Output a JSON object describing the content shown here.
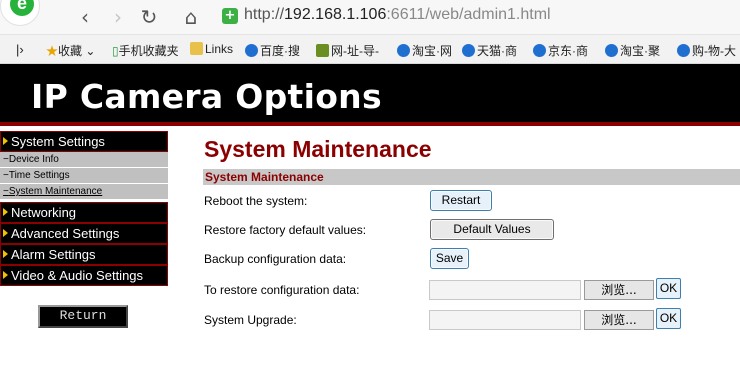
{
  "browser": {
    "url_prefix": "http://",
    "url_host": "192.168.1.106",
    "url_rest": ":6611/web/admin1.html",
    "bookmarks": [
      {
        "label": "收藏",
        "icon": "star-icon",
        "color": "#e8a400"
      },
      {
        "label": "手机收藏夹",
        "icon": "phone-icon",
        "color": "#2b9a3f"
      },
      {
        "label": "Links",
        "icon": "folder-icon",
        "color": "#e8c14a"
      },
      {
        "label": "百度·搜",
        "icon": "ie-icon",
        "color": "#1f6fd1"
      },
      {
        "label": "网-址-导-",
        "icon": "site-icon",
        "color": "#6b8e23"
      },
      {
        "label": "淘宝·网",
        "icon": "ie-icon",
        "color": "#1f6fd1"
      },
      {
        "label": "天猫·商",
        "icon": "ie-icon",
        "color": "#1f6fd1"
      },
      {
        "label": "京东·商",
        "icon": "ie-icon",
        "color": "#1f6fd1"
      },
      {
        "label": "淘宝·聚",
        "icon": "ie-icon",
        "color": "#1f6fd1"
      },
      {
        "label": "购-物-大",
        "icon": "ie-icon",
        "color": "#1f6fd1"
      }
    ],
    "logo_letter": "e"
  },
  "banner": {
    "title": "IP Camera Options"
  },
  "menu": {
    "system_settings": "System Settings",
    "sub": [
      "Device Info",
      "Time Settings",
      "System Maintenance"
    ],
    "networking": "Networking",
    "advanced": "Advanced Settings",
    "alarm": "Alarm Settings",
    "video_audio": "Video & Audio Settings",
    "return_label": "Return"
  },
  "main": {
    "title": "System Maintenance",
    "section": "System Maintenance",
    "reboot_label": "Reboot the system:",
    "restart_btn": "Restart",
    "factory_label": "Restore factory default values:",
    "default_btn": "Default Values",
    "backup_label": "Backup configuration data:",
    "save_btn": "Save",
    "restore_label": "To restore configuration data:",
    "upgrade_label": "System Upgrade:",
    "browse_btn": "浏览...",
    "ok_btn": "OK"
  },
  "colors": {
    "accent": "#8b0000",
    "menu_bg": "#000000",
    "submenu_bg": "#c0c0c0"
  }
}
